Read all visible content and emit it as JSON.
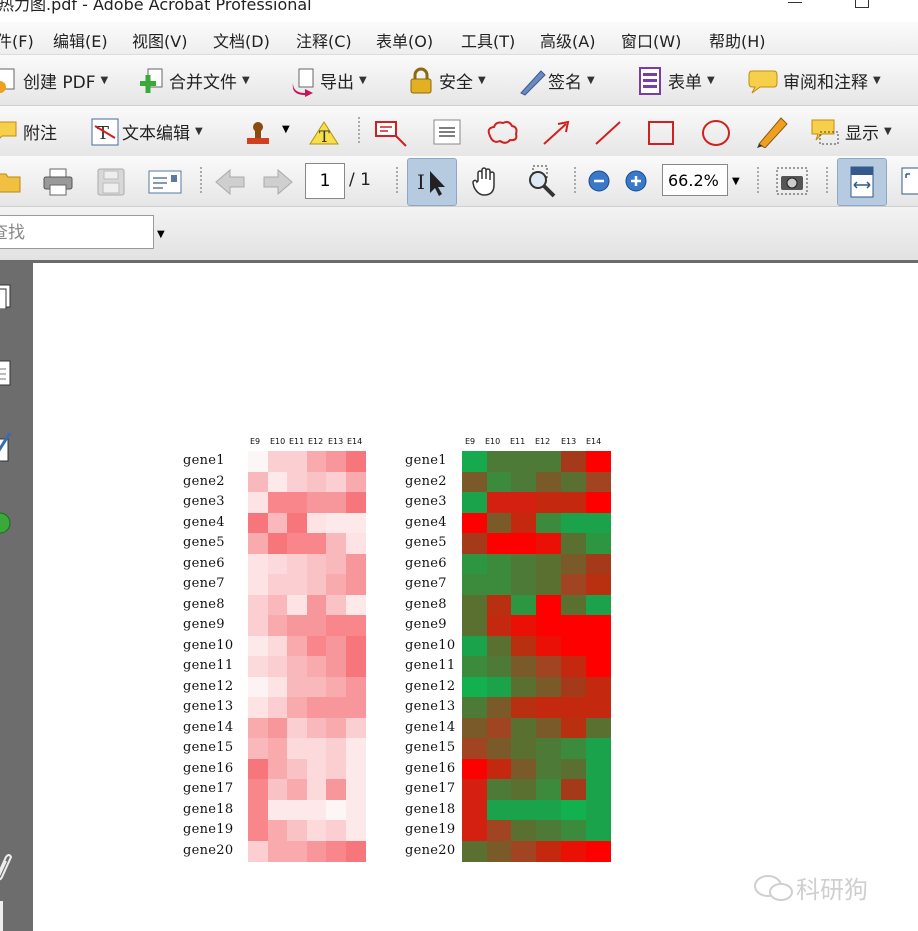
{
  "window": {
    "title": "热力图.pdf - Adobe Acrobat Professional"
  },
  "menu": [
    "件(F)",
    "编辑(E)",
    "视图(V)",
    "文档(D)",
    "注释(C)",
    "表单(O)",
    "工具(T)",
    "高级(A)",
    "窗口(W)",
    "帮助(H)"
  ],
  "toolbar1": {
    "create_pdf": "创建 PDF",
    "combine": "合并文件",
    "export": "导出",
    "secure": "安全",
    "sign": "签名",
    "forms": "表单",
    "review": "审阅和注释"
  },
  "toolbar2": {
    "comment": "附注",
    "text_edit": "文本编辑",
    "show": "显示"
  },
  "nav": {
    "page_current": "1",
    "page_total": "/ 1",
    "zoom": "66.2%"
  },
  "find": {
    "placeholder": "查找"
  },
  "heatmap": {
    "columns": [
      "E9",
      "E10",
      "E11",
      "E12",
      "E13",
      "E14"
    ],
    "genes": [
      "gene1",
      "gene2",
      "gene3",
      "gene4",
      "gene5",
      "gene6",
      "gene7",
      "gene8",
      "gene9",
      "gene10",
      "gene11",
      "gene12",
      "gene13",
      "gene14",
      "gene15",
      "gene16",
      "gene17",
      "gene18",
      "gene19",
      "gene20"
    ],
    "left_colors": [
      [
        "#fdf6f6",
        "#fbcfd1",
        "#fbcfd1",
        "#f9aaad",
        "#f8979b",
        "#f7767b"
      ],
      [
        "#f9b9bc",
        "#fde9ea",
        "#fbcfd1",
        "#f9c2c4",
        "#fbcfd1",
        "#f9aaad"
      ],
      [
        "#fde3e4",
        "#f8868a",
        "#f8868a",
        "#f8979b",
        "#f8979b",
        "#f7767b"
      ],
      [
        "#f7767b",
        "#f9b9bc",
        "#f7767b",
        "#fde3e4",
        "#fde9ea",
        "#fde9ea"
      ],
      [
        "#f9aaad",
        "#f7767b",
        "#f8868a",
        "#f8868a",
        "#f9b9bc",
        "#fde3e4"
      ],
      [
        "#fde3e4",
        "#fcd9da",
        "#fbcfd1",
        "#f9c2c4",
        "#f9b9bc",
        "#f8979b"
      ],
      [
        "#fde3e4",
        "#fbcfd1",
        "#fbcfd1",
        "#f9c2c4",
        "#f9aaad",
        "#f8979b"
      ],
      [
        "#fbcfd1",
        "#f9b9bc",
        "#fde3e4",
        "#f8979b",
        "#f9c2c4",
        "#fde9ea"
      ],
      [
        "#fbcfd1",
        "#f9aaad",
        "#f8979b",
        "#f8979b",
        "#f8868a",
        "#f8868a"
      ],
      [
        "#fde9ea",
        "#fcd9da",
        "#f9aaad",
        "#f8868a",
        "#f8979b",
        "#f7767b"
      ],
      [
        "#fcd9da",
        "#fbcfd1",
        "#f9b9bc",
        "#f9aaad",
        "#f8979b",
        "#f7767b"
      ],
      [
        "#fef3f4",
        "#fde3e4",
        "#f9b9bc",
        "#f9b9bc",
        "#f9aaad",
        "#f8979b"
      ],
      [
        "#fde3e4",
        "#fbcfd1",
        "#f9aaad",
        "#f8979b",
        "#f8979b",
        "#f8979b"
      ],
      [
        "#f9aaad",
        "#f8979b",
        "#fbcfd1",
        "#f9b9bc",
        "#f9aaad",
        "#fbcfd1"
      ],
      [
        "#f9b9bc",
        "#f9aaad",
        "#fcd9da",
        "#fcd9da",
        "#fbcfd1",
        "#fde9ea"
      ],
      [
        "#f7767b",
        "#f9aaad",
        "#f9c2c4",
        "#fcd9da",
        "#fbcfd1",
        "#fde9ea"
      ],
      [
        "#f8868a",
        "#f9c2c4",
        "#f9aaad",
        "#fcd9da",
        "#f8979b",
        "#fde9ea"
      ],
      [
        "#f8868a",
        "#fde9ea",
        "#fde9ea",
        "#fde9ea",
        "#fef6f6",
        "#fde9ea"
      ],
      [
        "#f8868a",
        "#f9aaad",
        "#f9c2c4",
        "#fcd9da",
        "#fbcfd1",
        "#fde9ea"
      ],
      [
        "#fbcfd1",
        "#f9aaad",
        "#f9aaad",
        "#f8979b",
        "#f8868a",
        "#f7767b"
      ]
    ],
    "right_colors": [
      [
        "#16a94d",
        "#4d7a36",
        "#4d7a36",
        "#4d7a36",
        "#a53a1b",
        "#ff0000"
      ],
      [
        "#7a5a28",
        "#3c8a3c",
        "#4d7a36",
        "#7a5a28",
        "#5a7030",
        "#a04422"
      ],
      [
        "#1aa34a",
        "#d42010",
        "#d42010",
        "#c4280f",
        "#c4280f",
        "#ff0000"
      ],
      [
        "#ff0000",
        "#7a5a28",
        "#c4280f",
        "#3c8a3c",
        "#1aa34a",
        "#1aa34a"
      ],
      [
        "#a53a1b",
        "#ff0000",
        "#ff0000",
        "#ea1006",
        "#5a7030",
        "#2d9640"
      ],
      [
        "#2d9640",
        "#3c8a3c",
        "#4d7a36",
        "#5a7030",
        "#7a5a28",
        "#a53a1b"
      ],
      [
        "#3c8a3c",
        "#3c8a3c",
        "#4d7a36",
        "#5a7030",
        "#a04422",
        "#b8300f"
      ],
      [
        "#5a7030",
        "#b8300f",
        "#2d9640",
        "#ff0000",
        "#5a7030",
        "#1aa34a"
      ],
      [
        "#5a7030",
        "#c4280f",
        "#ea1006",
        "#ff0000",
        "#ff0000",
        "#ff0000"
      ],
      [
        "#1aa34a",
        "#5a7030",
        "#b8300f",
        "#ea1006",
        "#ff0000",
        "#ff0000"
      ],
      [
        "#3c8a3c",
        "#4d7a36",
        "#7a5a28",
        "#a04422",
        "#c4280f",
        "#ff0000"
      ],
      [
        "#12b04e",
        "#1aa34a",
        "#5a7030",
        "#7a5a28",
        "#a53a1b",
        "#c4280f"
      ],
      [
        "#4d7a36",
        "#7a5a28",
        "#b8300f",
        "#c4280f",
        "#c4280f",
        "#c4280f"
      ],
      [
        "#7a5a28",
        "#a04422",
        "#5a7030",
        "#7a5a28",
        "#b8300f",
        "#5a7030"
      ],
      [
        "#a04422",
        "#7a5a28",
        "#5a7030",
        "#4d7a36",
        "#3c8a3c",
        "#1aa34a"
      ],
      [
        "#ff0000",
        "#c4280f",
        "#7a5a28",
        "#4d7a36",
        "#5a7030",
        "#1aa34a"
      ],
      [
        "#d42010",
        "#4d7a36",
        "#5a7030",
        "#3c8a3c",
        "#a53a1b",
        "#1aa34a"
      ],
      [
        "#d42010",
        "#1aa34a",
        "#1aa34a",
        "#1aa34a",
        "#12b04e",
        "#1aa34a"
      ],
      [
        "#d42010",
        "#a04422",
        "#5a7030",
        "#4d7a36",
        "#3c8a3c",
        "#1aa34a"
      ],
      [
        "#5a7030",
        "#7a5a28",
        "#a04422",
        "#c4280f",
        "#ea1006",
        "#ff0000"
      ]
    ]
  },
  "watermark": {
    "text": "科研狗"
  }
}
